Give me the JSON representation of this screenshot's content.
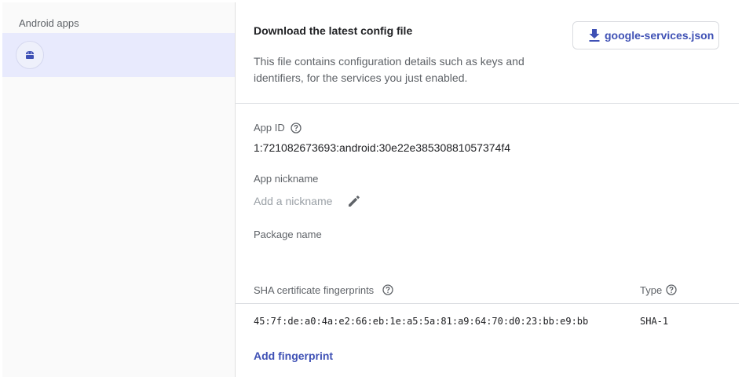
{
  "sidebar": {
    "heading": "Android apps",
    "selected_app_icon": "android-icon"
  },
  "config": {
    "title": "Download the latest config file",
    "description": "This file contains configuration details such as keys and identifiers, for the services you just enabled.",
    "download_label": "google-services.json",
    "download_icon": "download-icon"
  },
  "app_id": {
    "label": "App ID",
    "value": "1:721082673693:android:30e22e38530881057374f4"
  },
  "nickname": {
    "label": "App nickname",
    "placeholder": "Add a nickname",
    "edit_icon": "pencil-icon"
  },
  "package": {
    "label": "Package name",
    "value": ""
  },
  "sha": {
    "header_label": "SHA certificate fingerprints",
    "type_header": "Type",
    "rows": [
      {
        "fingerprint": "45:7f:de:a0:4a:e2:66:eb:1e:a5:5a:81:a9:64:70:d0:23:bb:e9:bb",
        "type": "SHA-1"
      }
    ],
    "add_label": "Add fingerprint"
  },
  "colors": {
    "accent": "#3f51b5",
    "selected_row": "#e8eafd",
    "sidebar_bg": "#fafafa"
  }
}
